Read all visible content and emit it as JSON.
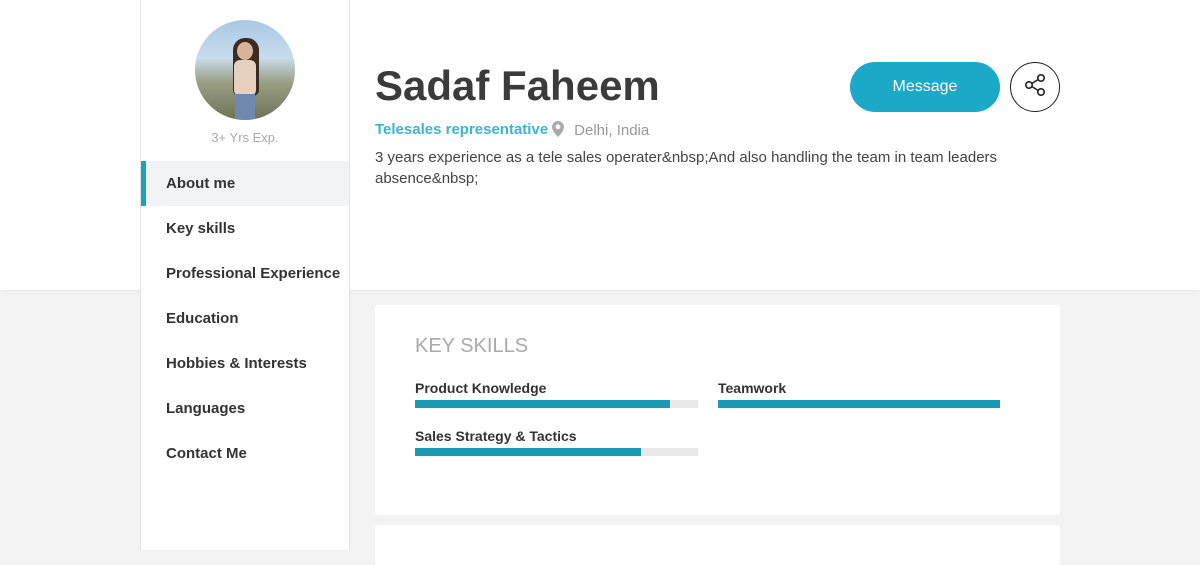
{
  "profile": {
    "name": "Sadaf Faheem",
    "title": "Telesales representative",
    "location": "Delhi, India",
    "bio": "3 years experience as a tele sales operater&nbsp;And also handling the team in team leaders absence&nbsp;",
    "experience": "3+ Yrs Exp."
  },
  "actions": {
    "message_label": "Message",
    "share_icon": "share-icon"
  },
  "sidebar": {
    "items": [
      {
        "label": "About me",
        "active": true
      },
      {
        "label": "Key skills"
      },
      {
        "label": "Professional Experience"
      },
      {
        "label": "Education"
      },
      {
        "label": "Hobbies & Interests"
      },
      {
        "label": "Languages"
      },
      {
        "label": "Contact Me"
      }
    ]
  },
  "key_skills": {
    "heading": "KEY SKILLS",
    "skills": [
      {
        "name": "Product Knowledge",
        "level": 0.9
      },
      {
        "name": "Teamwork",
        "level": 1.0
      },
      {
        "name": "Sales Strategy & Tactics",
        "level": 0.8
      }
    ]
  },
  "colors": {
    "accent": "#1aa9c6",
    "bar": "#1a9bb3",
    "title_text": "#3bb6cf"
  }
}
